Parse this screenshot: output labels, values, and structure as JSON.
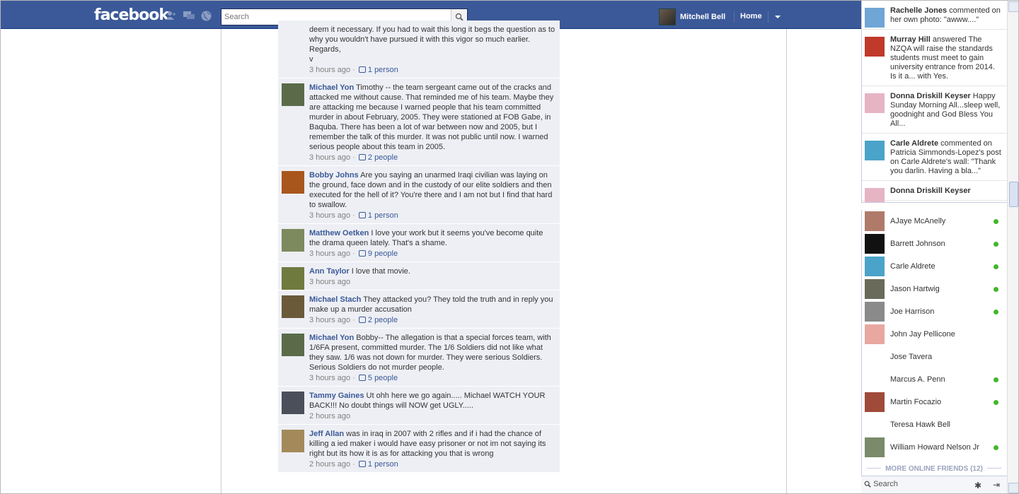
{
  "header": {
    "logo": "facebook",
    "search_placeholder": "Search",
    "user_name": "Mitchell Bell",
    "home_label": "Home"
  },
  "comments": [
    {
      "author": "",
      "text": "deem it necessary. If you had to wait this long it begs the question as to why you wouldn't have pursued it with this vigor so much earlier.",
      "text2": "Regards,",
      "text3": "v",
      "time": "3 hours ago",
      "likes": "1 person",
      "avatar_color": "#ffffff"
    },
    {
      "author": "Michael Yon",
      "text": "Timothy -- the team sergeant came out of the cracks and attacked me without cause. That reminded me of his team. Maybe they are attacking me because I warned people that his team committed murder in about February, 2005. They were stationed at FOB Gabe, in Baquba. There has been a lot of war between now and 2005, but I remember the talk of this murder. It was not public until now. I warned serious people about this team in 2005.",
      "time": "3 hours ago",
      "likes": "2 people",
      "avatar_color": "#5b6b4a"
    },
    {
      "author": "Bobby Johns",
      "text": "Are you saying an unarmed Iraqi civilian was laying on the ground, face down and in the custody of our elite soldiers and then executed for the hell of it? You're there and I am not but I find that hard to swallow.",
      "time": "3 hours ago",
      "likes": "1 person",
      "avatar_color": "#a9561c"
    },
    {
      "author": "Matthew Oetken",
      "text": "I love your work but it seems you've become quite the drama queen lately. That's a shame.",
      "time": "3 hours ago",
      "likes": "9 people",
      "avatar_color": "#7d8a5e"
    },
    {
      "author": "Ann Taylor",
      "text": "I love that movie.",
      "time": "3 hours ago",
      "likes": "",
      "avatar_color": "#6f7a3e"
    },
    {
      "author": "Michael Stach",
      "text": "They attacked you? They told the truth and in reply you make up a murder accusation",
      "time": "3 hours ago",
      "likes": "2 people",
      "avatar_color": "#6a5a3a"
    },
    {
      "author": "Michael Yon",
      "text": "Bobby-- The allegation is that a special forces team, with 1/6FA present, committed murder. The 1/6 Soldiers did not like what they saw. 1/6 was not down for murder. They were serious Soldiers. Serious Soldiers do not murder people.",
      "time": "3 hours ago",
      "likes": "5 people",
      "avatar_color": "#5b6b4a"
    },
    {
      "author": "Tammy Gaines",
      "text": "Ut ohh here we go again..... Michael WATCH YOUR BACK!!! No doubt things will NOW get UGLY.....",
      "time": "2 hours ago",
      "likes": "",
      "avatar_color": "#4a4f5a"
    },
    {
      "author": "Jeff Allan",
      "text": "was in iraq in 2007 with 2 rifles and if i had the chance of killing a ied maker i would have easy prisoner or not im not saying its right but its how it is as for attacking you that is wrong",
      "time": "2 hours ago",
      "likes": "1 person",
      "avatar_color": "#a48a5a"
    }
  ],
  "ticker": [
    {
      "name": "Rachelle Jones",
      "text": "commented on her own photo: \"awww....\"",
      "avatar_color": "#6fa6d6"
    },
    {
      "name": "Murray Hill",
      "text": "answered The NZQA will raise the standards students must meet to gain university entrance from 2014. Is it a... with Yes.",
      "avatar_color": "#c0392b"
    },
    {
      "name": "Donna Driskill Keyser",
      "text": "Happy Sunday Morning All...sleep well, goodnight and God Bless You All...",
      "avatar_color": "#e7b4c4"
    },
    {
      "name": "Carle Aldrete",
      "text": "commented on Patricia Simmonds-Lopez's post on Carle Aldrete's wall: \"Thank you darlin. Having a bla...\"",
      "avatar_color": "#4aa3c8"
    },
    {
      "name": "Donna Driskill Keyser",
      "text": "",
      "avatar_color": "#e7b4c4"
    }
  ],
  "chat_friends": [
    {
      "name": "AJaye McAnelly",
      "online": true,
      "avatar_color": "#b07a6a"
    },
    {
      "name": "Barrett Johnson",
      "online": true,
      "avatar_color": "#111111"
    },
    {
      "name": "Carle Aldrete",
      "online": true,
      "avatar_color": "#4aa3c8"
    },
    {
      "name": "Jason Hartwig",
      "online": true,
      "avatar_color": "#6a6a5a"
    },
    {
      "name": "Joe Harrison",
      "online": true,
      "avatar_color": "#8a8a8a"
    },
    {
      "name": "John Jay Pellicone",
      "online": false,
      "avatar_color": "#e8a8a0"
    },
    {
      "name": "Jose Tavera",
      "online": false,
      "avatar_color": ""
    },
    {
      "name": "Marcus A. Penn",
      "online": true,
      "avatar_color": ""
    },
    {
      "name": "Martin Focazio",
      "online": true,
      "avatar_color": "#a04a3a"
    },
    {
      "name": "Teresa Hawk Bell",
      "online": false,
      "avatar_color": ""
    },
    {
      "name": "William Howard Nelson Jr",
      "online": true,
      "avatar_color": "#7a8a6a"
    }
  ],
  "chat": {
    "more_label": "MORE ONLINE FRIENDS (12)",
    "search_label": "Search"
  }
}
